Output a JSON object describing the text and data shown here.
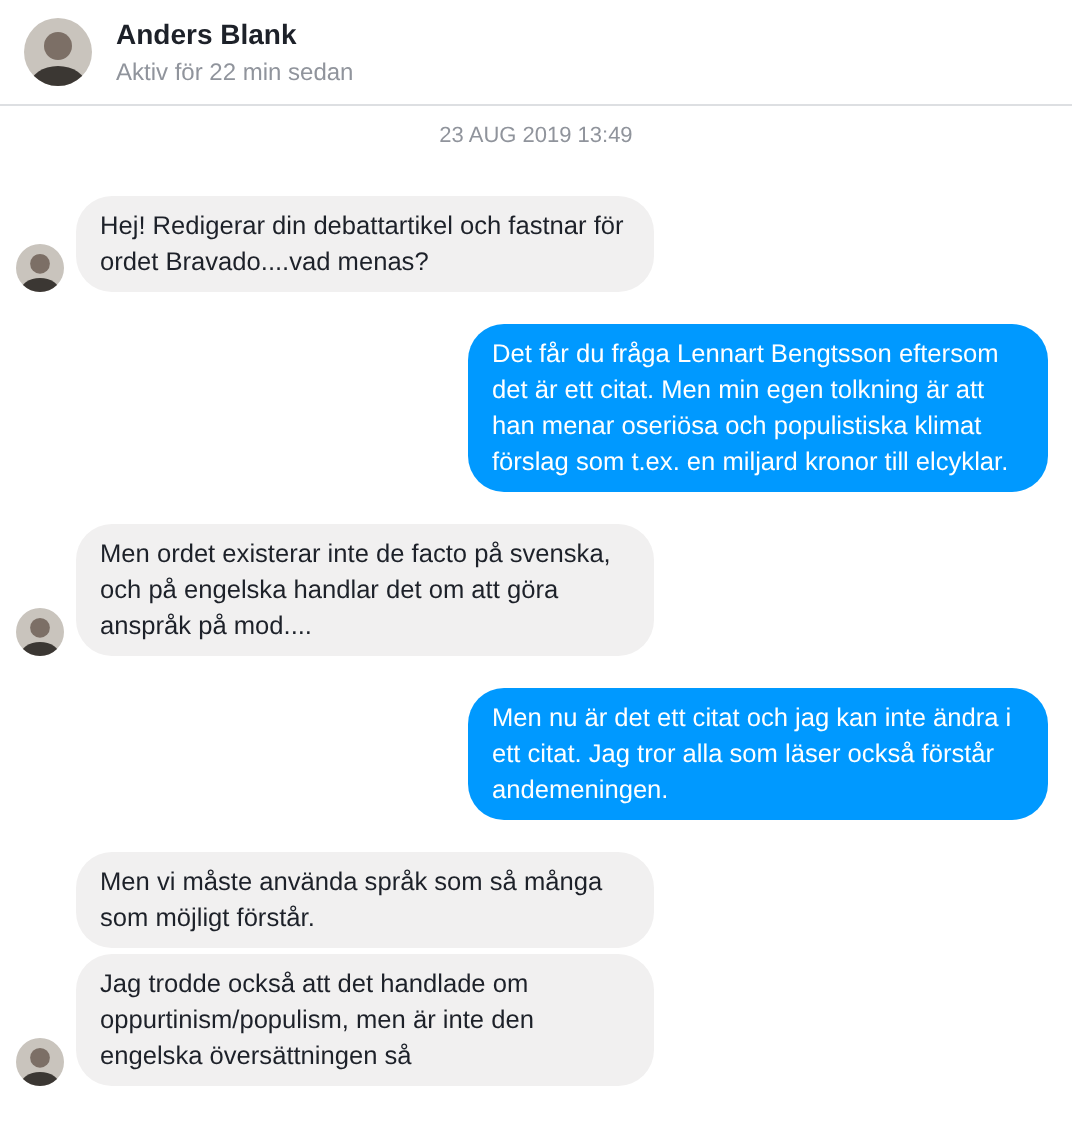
{
  "header": {
    "name": "Anders Blank",
    "status": "Aktiv för 22 min sedan"
  },
  "timestamp": "23 AUG 2019 13:49",
  "groups": [
    {
      "outgoing": false,
      "bubbles": [
        "Hej! Redigerar din debattartikel och fastnar för ordet Bravado....vad menas?"
      ]
    },
    {
      "outgoing": true,
      "bubbles": [
        "Det får du fråga Lennart Bengtsson eftersom det är ett citat. Men min egen tolkning är att han menar oseriösa och populistiska klimat förslag som t.ex. en miljard kronor till elcyklar."
      ]
    },
    {
      "outgoing": false,
      "bubbles": [
        "Men ordet existerar inte de facto på svenska, och på engelska handlar det om att göra anspråk på mod...."
      ]
    },
    {
      "outgoing": true,
      "bubbles": [
        "Men nu är det ett citat och jag kan inte ändra i ett citat. Jag tror alla som läser också förstår andemeningen."
      ]
    },
    {
      "outgoing": false,
      "bubbles": [
        "Men vi måste använda språk som så många som möjligt förstår.",
        "Jag trodde också att det handlade om oppurtinism/populism, men är inte den engelska översättningen så"
      ]
    }
  ]
}
